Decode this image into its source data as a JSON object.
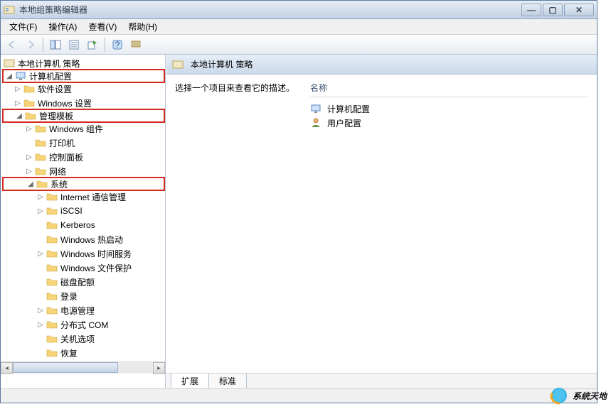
{
  "window": {
    "title": "本地组策略编辑器"
  },
  "menu": {
    "file": "文件(F)",
    "action": "操作(A)",
    "view": "查看(V)",
    "help": "帮助(H)"
  },
  "tree": {
    "root": "本地计算机 策略",
    "computer_config": "计算机配置",
    "software_settings": "软件设置",
    "windows_settings": "Windows 设置",
    "admin_templates": "管理模板",
    "windows_components": "Windows 组件",
    "printers": "打印机",
    "control_panel": "控制面板",
    "network": "网络",
    "system": "系统",
    "internet_comm": "Internet 通信管理",
    "iscsi": "iSCSI",
    "kerberos": "Kerberos",
    "hot_start": "Windows 热启动",
    "time_service": "Windows 时间服务",
    "file_protection": "Windows 文件保护",
    "disk_quota": "磁盘配额",
    "logon": "登录",
    "power_mgmt": "电源管理",
    "dcom": "分布式 COM",
    "shutdown_opts": "关机选项",
    "recovery": "恢复"
  },
  "content": {
    "header": "本地计算机 策略",
    "desc_prompt": "选择一个项目来查看它的描述。",
    "col_name": "名称",
    "items": {
      "computer_config": "计算机配置",
      "user_config": "用户配置"
    }
  },
  "tabs": {
    "extended": "扩展",
    "standard": "标准"
  },
  "watermark": "系统天地"
}
